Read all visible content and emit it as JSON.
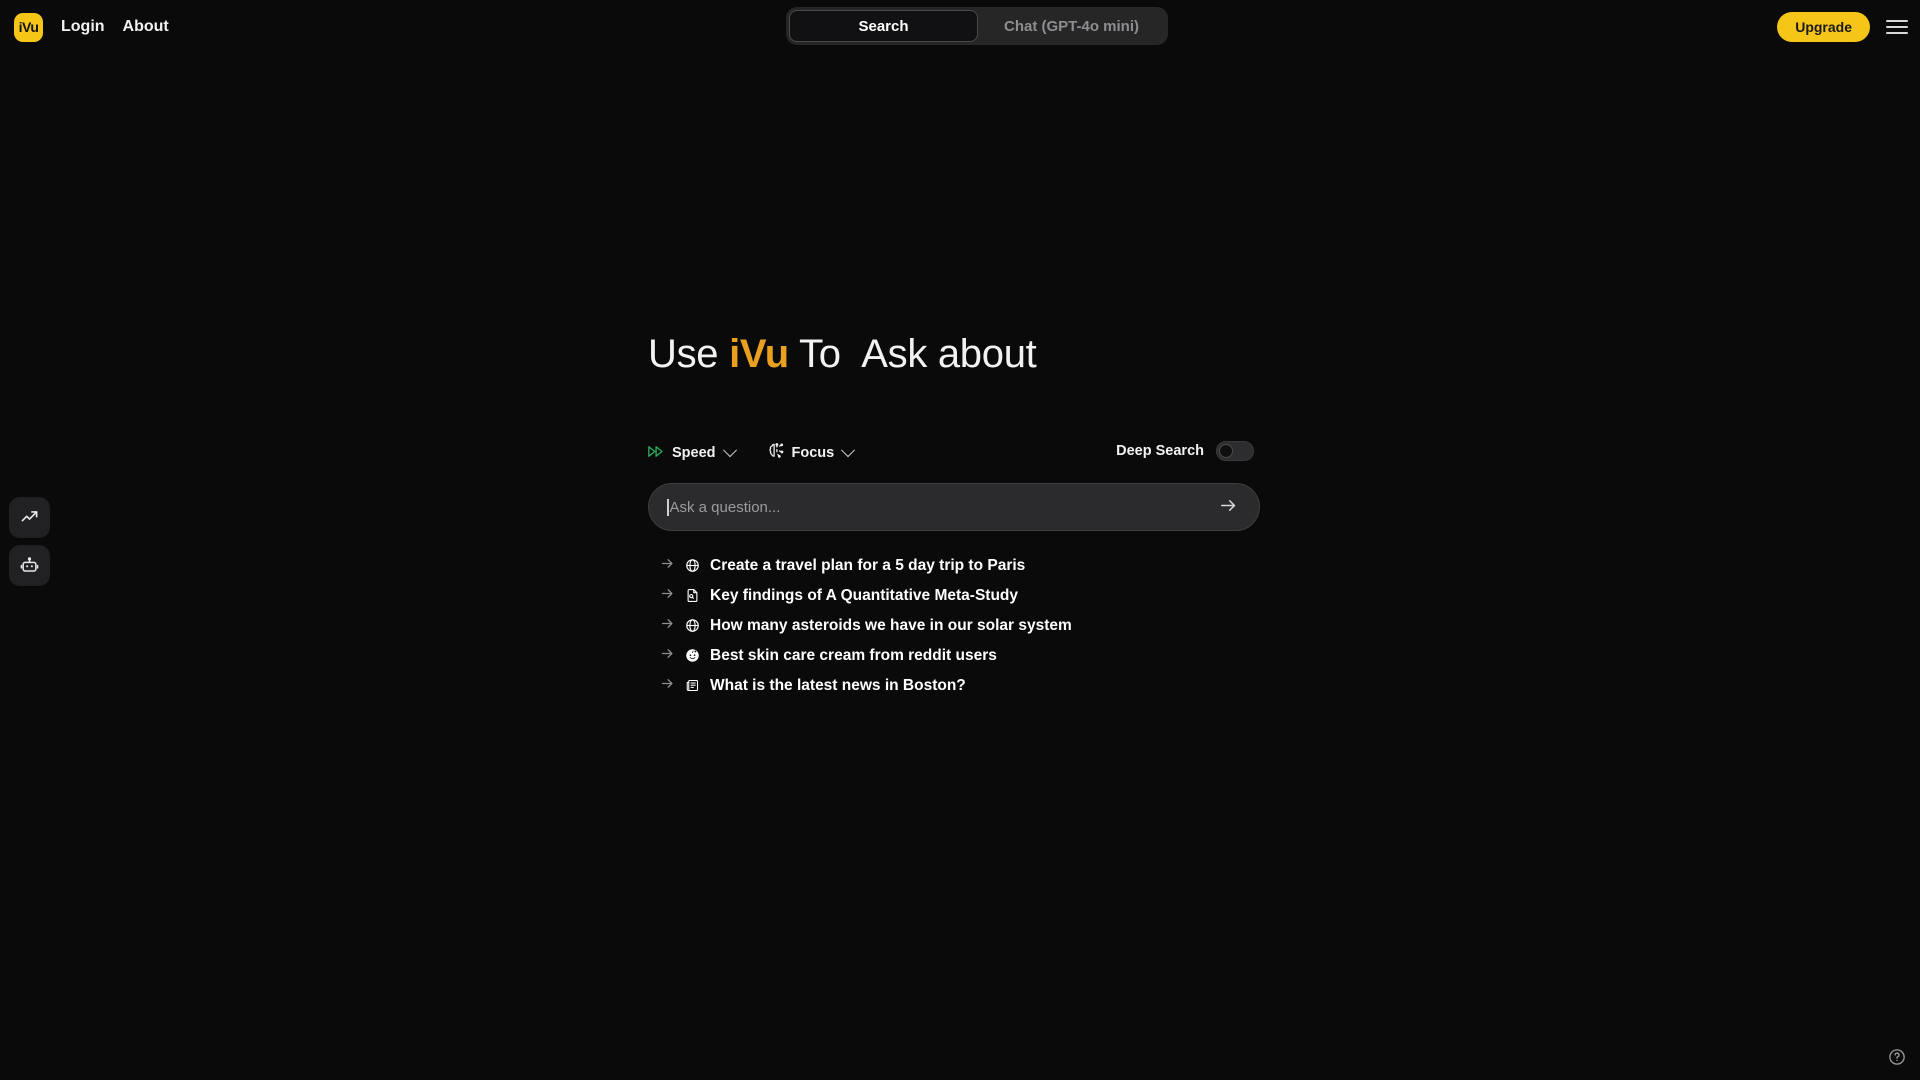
{
  "header": {
    "logo_text": "iVu",
    "logo_icon": "ivu-logo-icon",
    "nav": [
      {
        "label": "Login"
      },
      {
        "label": "About"
      }
    ],
    "tabs": [
      {
        "label": "Search",
        "active": true
      },
      {
        "label": "Chat (GPT-4o mini)",
        "active": false
      }
    ],
    "upgrade_label": "Upgrade",
    "menu_icon": "hamburger-menu-icon"
  },
  "rail": {
    "items": [
      {
        "icon": "trending-up-icon",
        "name": "trends"
      },
      {
        "icon": "robot-icon",
        "name": "assistant"
      }
    ]
  },
  "hero": {
    "prefix": "Use",
    "brand": "iVu",
    "middle": "To",
    "typed": "Ask about"
  },
  "controls": {
    "speed": {
      "label": "Speed",
      "icon": "fast-forward-icon",
      "chevron": "chevron-down-icon"
    },
    "focus": {
      "label": "Focus",
      "icon": "brain-icon",
      "chevron": "chevron-down-icon"
    },
    "deep_search": {
      "label": "Deep Search",
      "enabled": false
    }
  },
  "search": {
    "placeholder": "Ask a question...",
    "value": "",
    "submit_icon": "arrow-right-icon"
  },
  "suggestions": [
    {
      "text": "Create a travel plan for a 5 day trip to Paris",
      "icon": "globe-icon"
    },
    {
      "text": "Key findings of A Quantitative Meta-Study",
      "icon": "document-search-icon"
    },
    {
      "text": "How many asteroids we have in our solar system",
      "icon": "globe-icon"
    },
    {
      "text": "Best skin care cream from reddit users",
      "icon": "reddit-icon"
    },
    {
      "text": "What is the latest news in Boston?",
      "icon": "news-icon"
    }
  ],
  "footer": {
    "help_icon": "help-circle-icon"
  },
  "colors": {
    "background": "#0a0a0a",
    "accent_yellow": "#f5c518",
    "brand_amber": "#e9a020",
    "speed_green": "#2eaa5e",
    "surface": "#2b2b2d"
  }
}
